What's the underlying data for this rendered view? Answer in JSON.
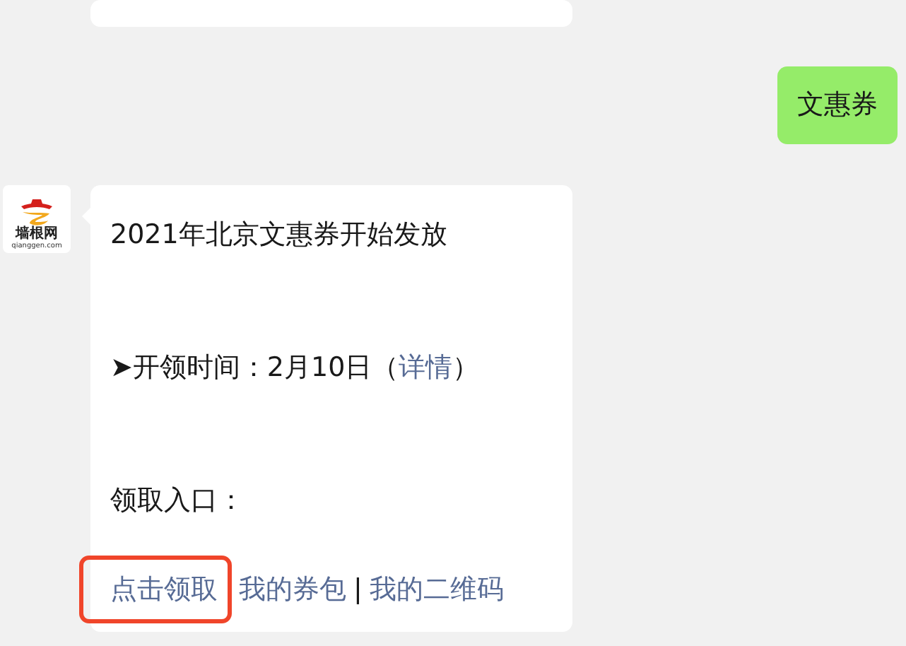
{
  "messages": [
    {
      "kind": "cut"
    },
    {
      "kind": "sent",
      "text": "文惠券"
    },
    {
      "kind": "received",
      "avatar": {
        "logo_text": "墙根网",
        "logo_caption": "qianggen.com"
      },
      "lines": [
        [
          {
            "text": "2021年北京文惠券开始发放",
            "link": false
          }
        ],
        [
          {
            "text": "➤开领时间：2月10日（",
            "link": false
          },
          {
            "text": "详情",
            "link": true
          },
          {
            "text": "）",
            "link": false
          }
        ],
        [
          {
            "text": "领取入口：",
            "link": false
          }
        ],
        [
          {
            "text": "点击领取",
            "link": true,
            "highlighted": true
          },
          {
            "text": "我的券包",
            "link": true,
            "highlighted": false
          },
          {
            "text": "|",
            "link": false
          },
          {
            "text": "我的二维码",
            "link": true,
            "highlighted": false
          }
        ]
      ]
    }
  ]
}
